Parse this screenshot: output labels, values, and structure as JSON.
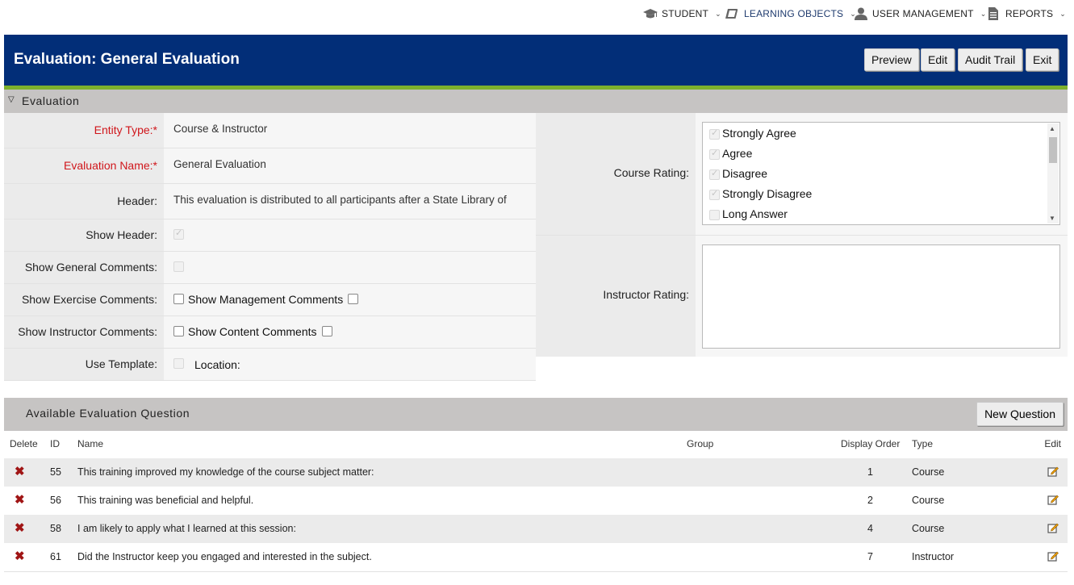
{
  "topnav": {
    "items": [
      {
        "label": "STUDENT",
        "icon": "graduation-cap-icon"
      },
      {
        "label": "LEARNING OBJECTS",
        "icon": "books-icon"
      },
      {
        "label": "USER MANAGEMENT",
        "icon": "user-icon"
      },
      {
        "label": "REPORTS",
        "icon": "document-icon"
      }
    ]
  },
  "header": {
    "title": "Evaluation: General Evaluation",
    "buttons": {
      "preview": "Preview",
      "edit": "Edit",
      "audit_trail": "Audit Trail",
      "exit": "Exit"
    }
  },
  "section": {
    "title": "Evaluation"
  },
  "form": {
    "entity_type": {
      "label": "Entity Type:*",
      "value": "Course & Instructor"
    },
    "evaluation_name": {
      "label": "Evaluation Name:*",
      "value": "General Evaluation"
    },
    "header": {
      "label": "Header:",
      "value": "This evaluation is distributed to all participants after a State Library of"
    },
    "show_header": {
      "label": "Show Header:"
    },
    "show_general_comments": {
      "label": "Show General Comments:"
    },
    "show_exercise_comments": {
      "label": "Show Exercise Comments:",
      "inline_label": "Show Management Comments"
    },
    "show_instructor_comments": {
      "label": "Show Instructor Comments:",
      "inline_label": "Show Content Comments"
    },
    "use_template": {
      "label": "Use Template:",
      "inline_label": "Location:"
    }
  },
  "ratings": {
    "course": {
      "label": "Course Rating:",
      "options": [
        "Strongly Agree",
        "Agree",
        "Disagree",
        "Strongly Disagree",
        "Long Answer"
      ]
    },
    "instructor": {
      "label": "Instructor Rating:"
    }
  },
  "questions": {
    "title": "Available Evaluation Question",
    "new_button": "New Question",
    "columns": {
      "delete": "Delete",
      "id": "ID",
      "name": "Name",
      "group": "Group",
      "display_order": "Display Order",
      "type": "Type",
      "edit": "Edit"
    },
    "rows": [
      {
        "id": "55",
        "name": "This training improved my knowledge of the course subject matter:",
        "group": "",
        "display_order": "1",
        "type": "Course"
      },
      {
        "id": "56",
        "name": "This training was beneficial and helpful.",
        "group": "",
        "display_order": "2",
        "type": "Course"
      },
      {
        "id": "58",
        "name": "I am likely to apply what I learned at this session:",
        "group": "",
        "display_order": "4",
        "type": "Course"
      },
      {
        "id": "61",
        "name": "Did the Instructor keep you engaged and interested in the subject.",
        "group": "",
        "display_order": "7",
        "type": "Instructor"
      }
    ]
  },
  "colors": {
    "header_bg": "#022e78",
    "accent_green": "#7db02c",
    "required_red": "#d0161b",
    "delete_red": "#a01515"
  }
}
